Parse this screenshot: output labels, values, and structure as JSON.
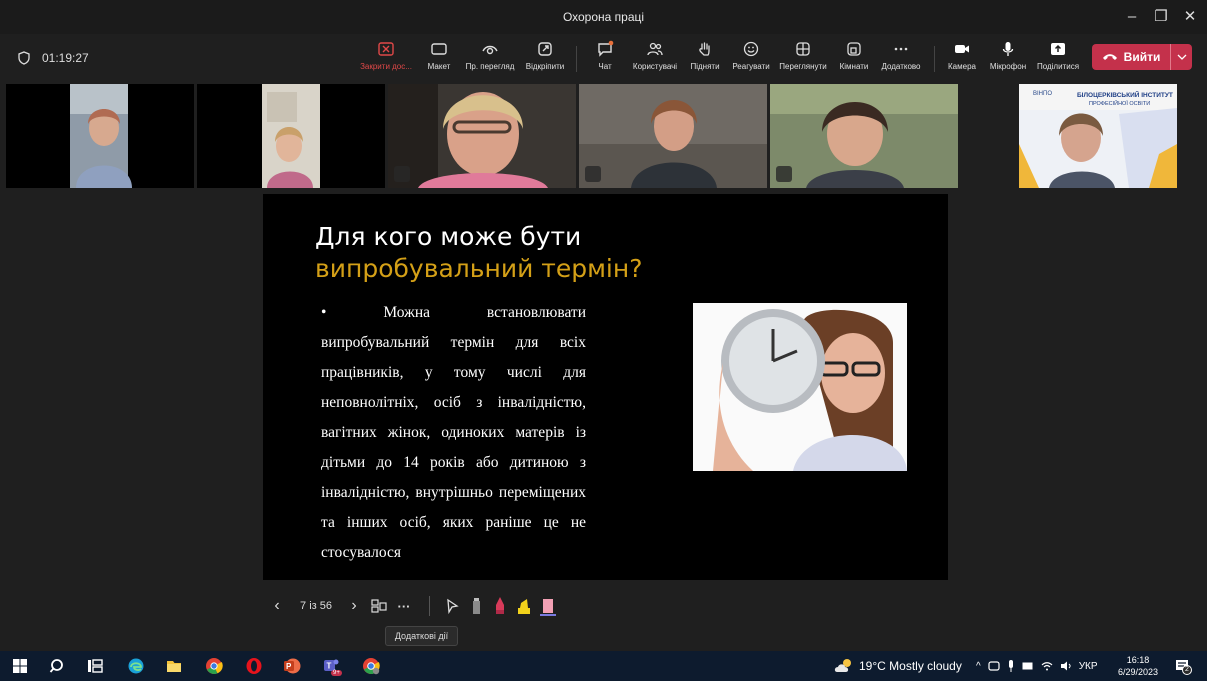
{
  "window": {
    "title": "Охорона праці",
    "minimize": "–",
    "maximize": "❐",
    "close": "✕"
  },
  "meeting": {
    "elapsed": "01:19:27"
  },
  "toolbar": {
    "close_share": "Закрити дос...",
    "layout": "Макет",
    "presenter_view": "Пр. перегляд",
    "pop_out": "Відкріпити",
    "chat": "Чат",
    "people": "Користувачі",
    "raise": "Підняти",
    "react": "Реагувати",
    "rooms_view": "Переглянути",
    "rooms": "Кімнати",
    "more": "Додатково",
    "camera": "Камера",
    "mic": "Мікрофон",
    "share": "Поділитися",
    "leave": "Вийти"
  },
  "slide": {
    "title_line1": "Для кого може бути",
    "title_line2": "випробувальний термін?",
    "body": "•   Можна встановлювати випробувальний термін для всіх працівників, у тому числі для неповнолітніх, осіб з інвалідністю, вагітних жінок, одиноких матерів із дітьми до 14 років або дитиною з інвалідністю, внутрішньо переміщених та інших осіб, яких раніше це не стосувалося"
  },
  "participant_slide": {
    "logo_text": "ВІНПО",
    "header_line1": "БІЛОЦЕРКІВСЬКИЙ ІНСТИТУТ",
    "header_line2": "ПРОФЕСІЙНОЇ ОСВІТИ"
  },
  "navigation": {
    "prev": "‹",
    "page": "7 із 56",
    "next": "›",
    "more": "···",
    "tooltip": "Додаткові дії"
  },
  "taskbar": {
    "weather": "19°C  Mostly cloudy",
    "lang": "УКР",
    "time": "16:18",
    "date": "6/29/2023",
    "notif_count": "2",
    "teams_badge": "9+"
  },
  "colors": {
    "accent_gold": "#d4a017",
    "leave_red": "#c4314b",
    "taskbar": "#0d1b2e"
  }
}
